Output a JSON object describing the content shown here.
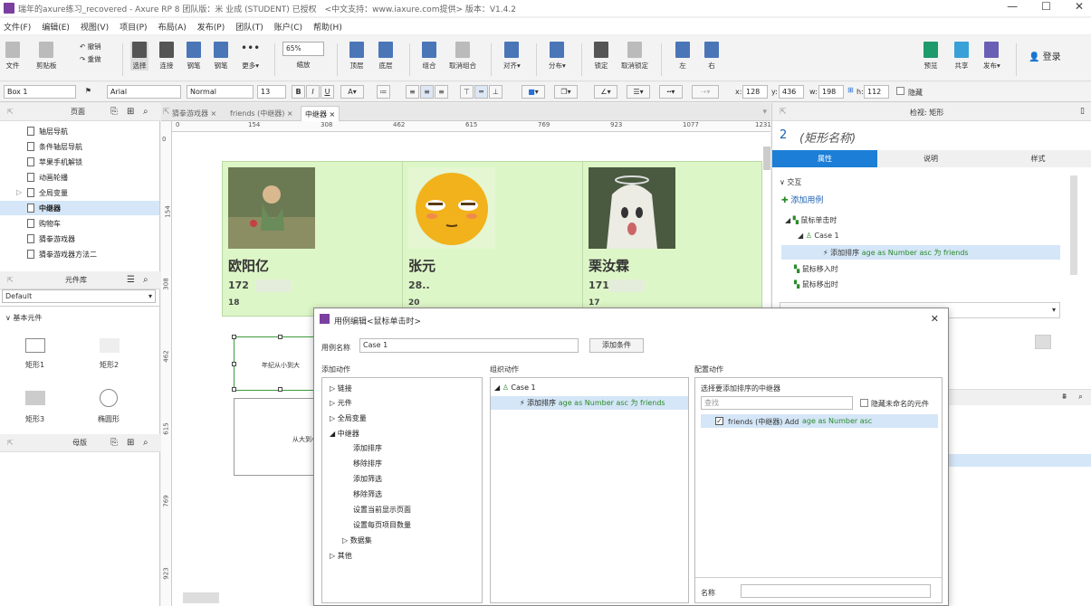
{
  "titlebar": {
    "title": "瑞年的axure练习_recovered - Axure RP 8 团队版：米 业成 (STUDENT) 已授权　<中文支持：www.iaxure.com提供> 版本：V1.4.2",
    "min": "—",
    "max": "☐",
    "close": "✕"
  },
  "menu": [
    "文件(F)",
    "编辑(E)",
    "视图(V)",
    "项目(P)",
    "布局(A)",
    "发布(P)",
    "团队(T)",
    "账户(C)",
    "帮助(H)"
  ],
  "toolbar": {
    "file": "文件",
    "clipboard": "剪贴板",
    "undo": "撤销",
    "redo": "重做",
    "select": "选择",
    "connect": "连接",
    "pen": "钢笔",
    "more": "更多▾",
    "zoom_value": "65%",
    "zoom_label": "缩放",
    "top": "顶层",
    "bottom": "底层",
    "group": "组合",
    "ungroup": "取消组合",
    "align": "对齐▾",
    "distribute": "分布▾",
    "lock": "锁定",
    "unlock": "取消锁定",
    "left": "左",
    "right": "右",
    "preview": "预览",
    "share": "共享",
    "publish": "发布▾",
    "login": "登录"
  },
  "formatbar": {
    "widget": "Box 1",
    "font": "Arial",
    "style": "Normal",
    "size": "13",
    "x_label": "x:",
    "x": "128",
    "y_label": "y:",
    "y": "436",
    "w_label": "w:",
    "w": "198",
    "h_label": "h:",
    "h": "112",
    "hidden": "隐藏"
  },
  "pages_panel": {
    "title": "页面",
    "items": [
      "轴层导航",
      "条件轴层导航",
      "苹果手机解锁",
      "动画轮播",
      "全局变量",
      "中继器",
      "购物车",
      "猜拳游戏器",
      "猜拳游戏器方法二"
    ],
    "active": "中继器"
  },
  "library_panel": {
    "title": "元件库",
    "selected": "Default",
    "section": "基本元件",
    "items": [
      "矩形1",
      "矩形2",
      "矩形3",
      "椭圆形"
    ]
  },
  "masters_panel": {
    "title": "母版"
  },
  "tabs": [
    {
      "label": "猜拳游戏器 ×"
    },
    {
      "label": "friends (中继器) ×"
    },
    {
      "label": "中继器 ×"
    }
  ],
  "ruler_h": [
    "0",
    "154",
    "308",
    "462",
    "615",
    "769",
    "923",
    "1077",
    "1231"
  ],
  "ruler_v": [
    "0",
    "154",
    "308",
    "462",
    "615",
    "769",
    "923"
  ],
  "cards": [
    {
      "name": "欧阳亿",
      "num": "172",
      "age": "18"
    },
    {
      "name": "张元",
      "num": "28..",
      "age": "20"
    },
    {
      "name": "栗汝霖",
      "num": "171",
      "age": "17"
    }
  ],
  "canvas_texts": {
    "t1": "年纪从小到大",
    "t2": "从大到小"
  },
  "inspector": {
    "title": "检视: 矩形",
    "shape_num": "2",
    "shape_name": "(矩形名称)",
    "tabs": [
      "属性",
      "说明",
      "样式"
    ],
    "interaction": "交互",
    "add_case": "添加用例",
    "onclick": "鼠标单击时",
    "case1": "Case 1",
    "action": "添加排序",
    "action_detail": "age as Number asc 为 friends",
    "mouseenter": "鼠标移入时",
    "mouseleave": "鼠标移出时"
  },
  "dialog": {
    "title": "用例编辑<鼠标单击时>",
    "close": "✕",
    "case_name_label": "用例名称",
    "case_name": "Case 1",
    "add_condition": "添加条件",
    "col_add": "添加动作",
    "col_organize": "组织动作",
    "col_config": "配置动作",
    "actions": [
      "链接",
      "元件",
      "全局变量",
      "中继器",
      "添加排序",
      "移除排序",
      "添加筛选",
      "移除筛选",
      "设置当前显示页面",
      "设置每页项目数量",
      "数据集",
      "其他"
    ],
    "org_case": "Case 1",
    "org_action": "添加排序",
    "org_detail": "age as Number asc 为 friends",
    "config_title": "选择要添加排序的中继器",
    "search_placeholder": "查找",
    "hide_unnamed": "隐藏未命名的元件",
    "config_item": "friends (中继器) Add",
    "config_item_detail": "age as Number asc",
    "name_label": "名称"
  }
}
